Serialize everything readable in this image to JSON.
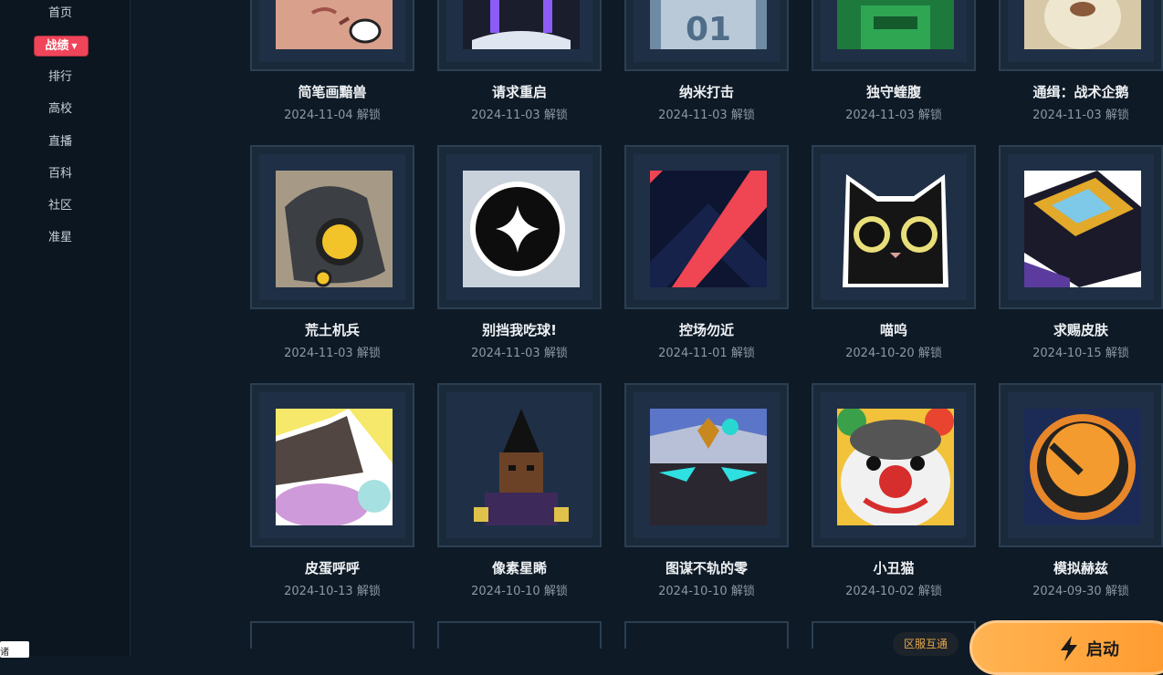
{
  "sidebar": {
    "items": [
      "首页",
      "排行",
      "高校",
      "直播",
      "百科",
      "社区",
      "准星"
    ],
    "active": "战绩"
  },
  "unlock_label": "解锁",
  "cards": [
    {
      "title": "简笔画黯兽",
      "date": "2024-11-04",
      "icon": "sketch-beast-face"
    },
    {
      "title": "请求重启",
      "date": "2024-11-03",
      "icon": "purple-robot"
    },
    {
      "title": "纳米打击",
      "date": "2024-11-03",
      "icon": "nano-01-badge"
    },
    {
      "title": "独守蝰腹",
      "date": "2024-11-03",
      "icon": "green-mech"
    },
    {
      "title": "通缉：战术企鹅",
      "date": "2024-11-03",
      "icon": "tactical-penguin"
    },
    {
      "title": "荒土机兵",
      "date": "2024-11-03",
      "icon": "wasteland-robot"
    },
    {
      "title": "别挡我吃球!",
      "date": "2024-11-03",
      "icon": "black-star-orb"
    },
    {
      "title": "控场勿近",
      "date": "2024-11-01",
      "icon": "red-chevron-emblem"
    },
    {
      "title": "喵呜",
      "date": "2024-10-20",
      "icon": "black-cat"
    },
    {
      "title": "求赐皮肤",
      "date": "2024-10-15",
      "icon": "gold-armored-car"
    },
    {
      "title": "皮蛋呼呼",
      "date": "2024-10-13",
      "icon": "sleepy-creature"
    },
    {
      "title": "像素星睎",
      "date": "2024-10-10",
      "icon": "pixel-character"
    },
    {
      "title": "图谋不轨的零",
      "date": "2024-10-10",
      "icon": "masked-helmet"
    },
    {
      "title": "小丑猫",
      "date": "2024-10-02",
      "icon": "clown-cat"
    },
    {
      "title": "模拟赫兹",
      "date": "2024-09-30",
      "icon": "orange-knob"
    }
  ],
  "footer": {
    "server_badge": "区服互通",
    "launch": "启动",
    "corner_chip": "诸"
  }
}
